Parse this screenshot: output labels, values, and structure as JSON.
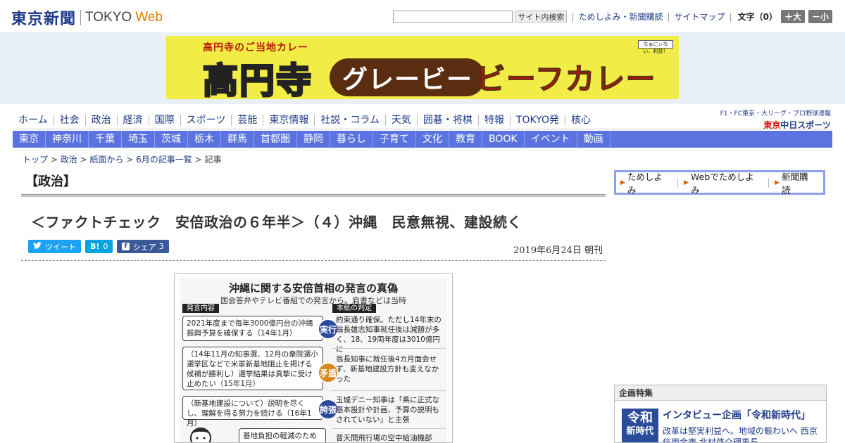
{
  "header": {
    "logo_jp": "東京新聞",
    "logo_en1": "TOKYO",
    "logo_en2": "Web",
    "search_btn": "サイト内検索",
    "links": [
      "ためしよみ・新聞購読",
      "サイトマップ"
    ],
    "fontsize_label": "文字（0）",
    "font_up": "＋大",
    "font_down": "－小"
  },
  "ad": {
    "sub": "高円寺のご当地カレー",
    "big": "高円寺",
    "pill": "グレービー",
    "right": "ビーフカレー",
    "badge": "なぁにぃない、利益！"
  },
  "gnav": [
    "ホーム",
    "社会",
    "政治",
    "経済",
    "国際",
    "スポーツ",
    "芸能",
    "東京情報",
    "社説・コラム",
    "天気",
    "囲碁・将棋",
    "特報",
    "TOKYO発",
    "核心"
  ],
  "sports_promo": {
    "sub": "F1・FC東京・大リーグ・プロ野球速報",
    "logo_prefix": "東京",
    "logo_main": "中日スポーツ"
  },
  "lnav": [
    "東京",
    "神奈川",
    "千葉",
    "埼玉",
    "茨城",
    "栃木",
    "群馬",
    "首都圏",
    "静岡",
    "暮らし",
    "子育て",
    "文化",
    "教育",
    "BOOK",
    "イベント",
    "動画"
  ],
  "breadcrumb": [
    "トップ",
    "政治",
    "紙面から",
    "6月の記事一覧"
  ],
  "breadcrumb_sep": " > ",
  "breadcrumb_current": "記事",
  "article": {
    "section": "【政治】",
    "headline": "＜ファクトチェック　安倍政治の６年半＞（４）沖縄　民意無視、建設続く",
    "tweet": "ツイート",
    "hatena_count": "0",
    "fb_label": "シェア",
    "fb_count": "3",
    "date": "2019年6月24日 朝刊"
  },
  "figure": {
    "title": "沖縄に関する安倍首相の発言の真偽",
    "subtitle": "国会答弁やテレビ番組での発言から。肩書などは当時",
    "tab_left": "発言内容",
    "tab_right": "本紙の判定",
    "rows": [
      {
        "quote": "2021年度まで毎年3000億円台の沖縄振興予算を確保する（14年1月）",
        "seal": "実行",
        "verdict": "約束通り確保。ただし14年末の翁長雄志知事就任後は減額が多く、18、19両年度は3010億円に"
      },
      {
        "quote": "（14年11月の知事選、12月の衆院選小選挙区などで米軍新基地阻止を掲げる候補が勝利し）選挙結果は真摯に受け止めたい（15年1月）",
        "seal": "矛盾",
        "verdict": "翁長知事に就任後4カ月面会せず、新基地建設方針も変えなかった"
      },
      {
        "quote": "（新基地建設について）説明を尽くし、理解を得る努力を続ける（16年1月）",
        "seal": "誇張",
        "verdict": "玉城デニー知事は「県に正式な基本設計や計画、予算の説明もされていない」と主張"
      },
      {
        "quote": "基地負担の軽減のため",
        "seal": "",
        "verdict": "普天間飛行場の空中給油機部"
      }
    ]
  },
  "sidebar": {
    "links": [
      "ためしよみ",
      "Webでためしよみ",
      "新聞購読"
    ],
    "feature_head": "企画特集",
    "feature_thumb": [
      "令和",
      "新時代"
    ],
    "feature_title": "インタビュー企画「令和新時代」",
    "feature_desc": "改革は堅実利益へ。地域の賑わいへ 西京信用金庫 北村啓介理事長"
  },
  "colors": {
    "brand": "#1e3a8a",
    "local_nav": "#5a73e0",
    "ad_bg": "#f2ec46",
    "twitter": "#1da1f2",
    "hatena": "#00a4de",
    "facebook": "#3b5998"
  }
}
